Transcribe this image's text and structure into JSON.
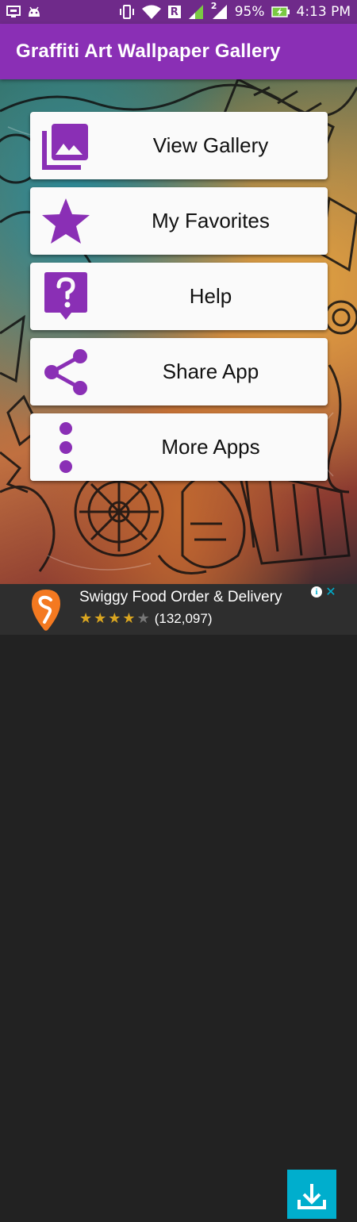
{
  "status_bar": {
    "battery_percent": "95%",
    "time": "4:13 PM",
    "roaming_label": "R",
    "sim_label": "2",
    "icons": [
      "screen-cast-icon",
      "android-icon",
      "vibrate-icon",
      "wifi-icon",
      "signal-icon",
      "signal-icon",
      "battery-charging-icon"
    ]
  },
  "app_bar": {
    "title": "Graffiti Art Wallpaper Gallery"
  },
  "menu": {
    "items": [
      {
        "label": "View Gallery",
        "icon": "gallery-icon"
      },
      {
        "label": "My Favorites",
        "icon": "star-icon"
      },
      {
        "label": "Help",
        "icon": "help-icon"
      },
      {
        "label": "Share App",
        "icon": "share-icon"
      },
      {
        "label": "More Apps",
        "icon": "more-vertical-icon"
      }
    ]
  },
  "ad": {
    "title": "Swiggy Food Order & Delivery",
    "rating": 4,
    "max_rating": 5,
    "review_count": "(132,097)",
    "info_glyph": "i",
    "close_glyph": "✕"
  },
  "colors": {
    "status_bar": "#6f2a8a",
    "app_bar": "#8a2fb5",
    "accent": "#8a2fb5",
    "card_bg": "#fafafa",
    "ad_bg": "#2e2e2e",
    "ad_accent": "#00aecd",
    "swiggy_orange": "#f47920"
  }
}
